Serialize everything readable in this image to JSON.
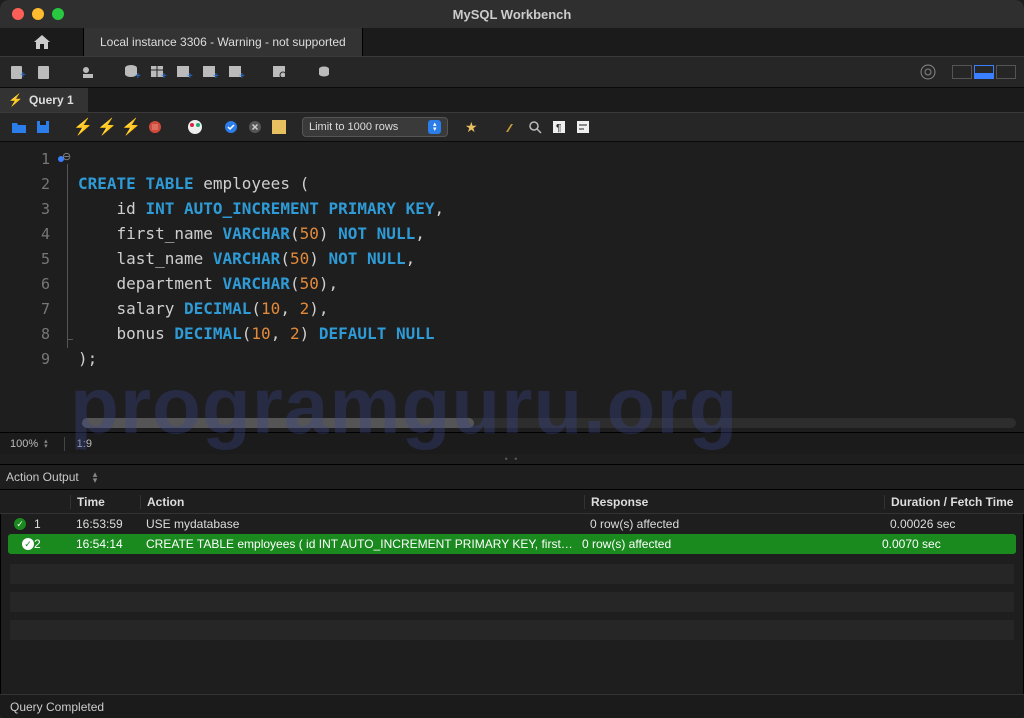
{
  "window": {
    "title": "MySQL Workbench"
  },
  "connection_tab": {
    "label": "Local instance 3306 - Warning - not supported"
  },
  "query_tab": {
    "label": "Query 1"
  },
  "sql_toolbar": {
    "limit_label": "Limit to 1000 rows"
  },
  "code_lines": [
    "CREATE TABLE employees (",
    "    id INT AUTO_INCREMENT PRIMARY KEY,",
    "    first_name VARCHAR(50) NOT NULL,",
    "    last_name VARCHAR(50) NOT NULL,",
    "    department VARCHAR(50),",
    "    salary DECIMAL(10, 2),",
    "    bonus DECIMAL(10, 2) DEFAULT NULL",
    ");",
    ""
  ],
  "gutter": [
    "1",
    "2",
    "3",
    "4",
    "5",
    "6",
    "7",
    "8",
    "9"
  ],
  "editor_status": {
    "zoom": "100%",
    "cursor": "1:9"
  },
  "watermark": "programguru.org",
  "output": {
    "selector_label": "Action Output",
    "headers": {
      "time": "Time",
      "action": "Action",
      "response": "Response",
      "duration": "Duration / Fetch Time"
    },
    "rows": [
      {
        "idx": "1",
        "time": "16:53:59",
        "action": "USE mydatabase",
        "response": "0 row(s) affected",
        "duration": "0.00026 sec",
        "selected": false
      },
      {
        "idx": "2",
        "time": "16:54:14",
        "action": "CREATE TABLE employees (     id INT AUTO_INCREMENT PRIMARY KEY,     first_n…",
        "response": "0 row(s) affected",
        "duration": "0.0070 sec",
        "selected": true
      }
    ]
  },
  "status_bar": {
    "text": "Query Completed"
  }
}
